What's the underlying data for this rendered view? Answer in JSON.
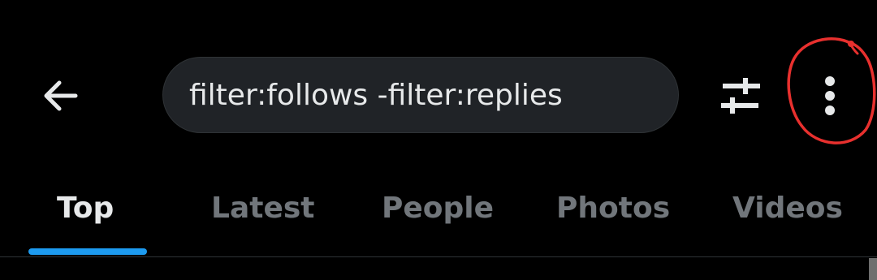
{
  "header": {
    "back_icon": "arrow-left-icon",
    "search": {
      "value": "filter:follows -filter:replies"
    },
    "filter_icon": "sliders-icon",
    "more_icon": "vertical-ellipsis-icon"
  },
  "tabs": [
    {
      "label": "Top",
      "active": true
    },
    {
      "label": "Latest",
      "active": false
    },
    {
      "label": "People",
      "active": false
    },
    {
      "label": "Photos",
      "active": false
    },
    {
      "label": "Videos",
      "active": false
    }
  ],
  "colors": {
    "background": "#000000",
    "search_bg": "#202327",
    "text_primary": "#e7e9ea",
    "text_secondary": "#71767b",
    "accent": "#1d9bf0",
    "annotation": "#e8302e",
    "divider": "#2f3336"
  }
}
